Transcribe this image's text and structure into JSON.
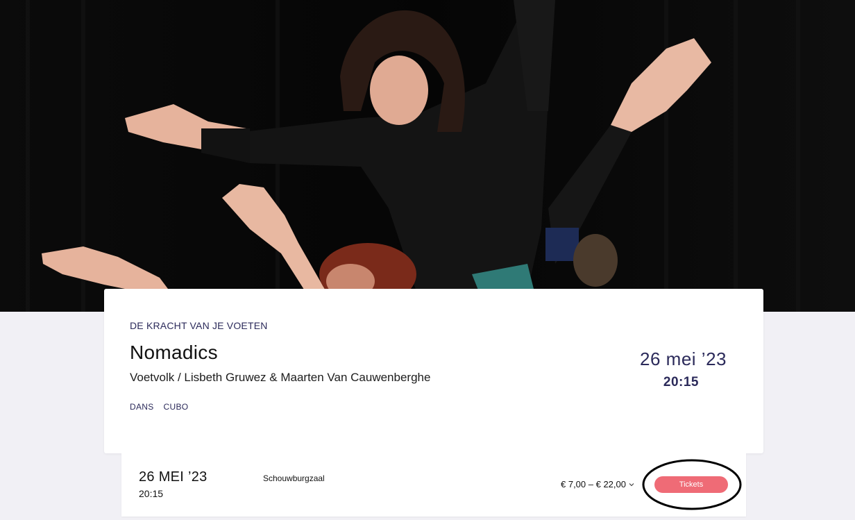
{
  "hero": {
    "image_description_icon": "dancers-photo"
  },
  "event": {
    "kicker": "DE KRACHT VAN JE VOETEN",
    "title": "Nomadics",
    "subtitle": "Voetvolk / Lisbeth Gruwez & Maarten Van Cauwenberghe",
    "tags": [
      "DANS",
      "CUBO"
    ],
    "date": "26 mei ’23",
    "time": "20:15"
  },
  "performance": {
    "date": "26 MEI ’23",
    "time": "20:15",
    "venue": "Schouwburgzaal",
    "price_range": "€ 7,00 – € 22,00",
    "tickets_label": "Tickets"
  },
  "colors": {
    "accent_navy": "#2b2a5a",
    "ticket_button": "#ef6b76",
    "page_background": "#f1f0f5"
  }
}
